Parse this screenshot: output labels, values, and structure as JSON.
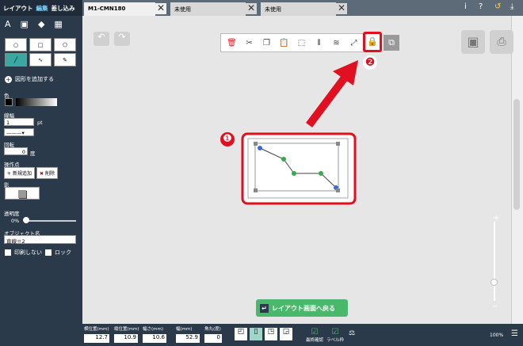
{
  "sidebar": {
    "tabs": [
      "レイアウト",
      "編集",
      "差し込み"
    ],
    "add_shape": "図形を追加する",
    "color_label": "色",
    "line_label": "線幅",
    "line_width": "1",
    "line_unit": "pt",
    "rotate_label": "回転",
    "rotate_value": "0",
    "rotate_unit": "度",
    "points_label": "操作点",
    "add_point": "新規追加",
    "delete_point": "削除",
    "shadow_label": "影",
    "opacity_label": "透明度",
    "opacity_value": "0%",
    "objname_label": "オブジェクト名",
    "objname_value": "直線＝2",
    "noprint": "印刷しない",
    "lock": "ロック"
  },
  "tabs": [
    "M1-CMN180",
    "未使用",
    "未使用"
  ],
  "top_icons": [
    "i",
    "?",
    "↺",
    "⤓"
  ],
  "toolbar_icons": [
    "trash-icon",
    "scissors-icon",
    "copy-icon",
    "paste-icon",
    "select-icon",
    "align-icon",
    "layer-icon",
    "resize-icon",
    "lock-icon",
    "ungroup-icon"
  ],
  "annotations": {
    "one": "❶",
    "two": "❷"
  },
  "back_button": "レイアウト画面へ戻る",
  "bottom": {
    "labels": [
      "横位置(mm)",
      "縦位置(mm)",
      "幅さ(mm)",
      "幅(mm)",
      "角丸(度)"
    ],
    "values": [
      "12.7",
      "10.9",
      "10.6",
      "52.9",
      "0"
    ],
    "check_labels": [
      "最終確認",
      "ラベル枠"
    ],
    "zoom": "100%"
  },
  "colors": {
    "accent": "#e01020",
    "sidebar": "#2b3a4a",
    "green": "#3aa84a"
  }
}
